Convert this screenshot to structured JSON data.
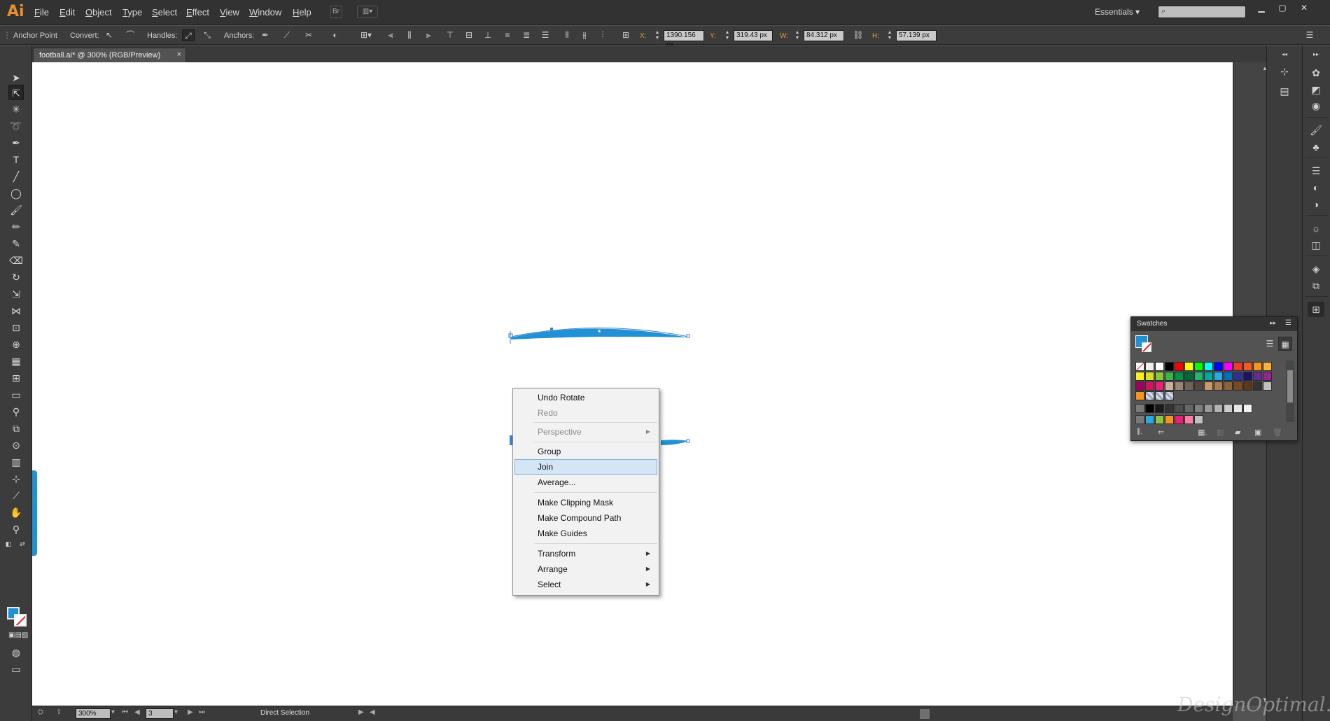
{
  "app": {
    "logo": "Ai",
    "workspace": "Essentials"
  },
  "menu": [
    {
      "label": "File",
      "u": "F",
      "rest": "ile"
    },
    {
      "label": "Edit",
      "u": "E",
      "rest": "dit"
    },
    {
      "label": "Object",
      "u": "O",
      "rest": "bject"
    },
    {
      "label": "Type",
      "u": "T",
      "rest": "ype"
    },
    {
      "label": "Select",
      "u": "S",
      "rest": "elect"
    },
    {
      "label": "Effect",
      "u": "E",
      "rest": "ffect"
    },
    {
      "label": "View",
      "u": "V",
      "rest": "iew"
    },
    {
      "label": "Window",
      "u": "W",
      "rest": "indow"
    },
    {
      "label": "Help",
      "u": "H",
      "rest": "elp"
    }
  ],
  "control": {
    "tool_name": "Anchor Point",
    "convert_label": "Convert:",
    "handles_label": "Handles:",
    "anchors_label": "Anchors:",
    "x_label": "X:",
    "x_value": "1390.156 px",
    "y_label": "Y:",
    "y_value": "319.43 px",
    "w_label": "W:",
    "w_value": "84.312 px",
    "h_label": "H:",
    "h_value": "57.139 px"
  },
  "document": {
    "tab_title": "football.ai* @ 300% (RGB/Preview)",
    "close": "×"
  },
  "status": {
    "zoom": "300%",
    "artboard": "3",
    "tool": "Direct Selection"
  },
  "swatches_panel": {
    "title": "Swatches",
    "fill_color": "#2191d6"
  },
  "context_menu": {
    "items": [
      {
        "label": "Undo Rotate",
        "disabled": false,
        "submenu": false
      },
      {
        "label": "Redo",
        "disabled": true,
        "submenu": false
      },
      {
        "label": "Perspective",
        "disabled": true,
        "submenu": true
      },
      {
        "label": "Group",
        "disabled": false,
        "submenu": false
      },
      {
        "label": "Join",
        "disabled": false,
        "submenu": false,
        "highlighted": true
      },
      {
        "label": "Average...",
        "disabled": false,
        "submenu": false
      },
      {
        "label": "Make Clipping Mask",
        "disabled": false,
        "submenu": false
      },
      {
        "label": "Make Compound Path",
        "disabled": false,
        "submenu": false
      },
      {
        "label": "Make Guides",
        "disabled": false,
        "submenu": false
      },
      {
        "label": "Transform",
        "disabled": false,
        "submenu": true
      },
      {
        "label": "Arrange",
        "disabled": false,
        "submenu": true
      },
      {
        "label": "Select",
        "disabled": false,
        "submenu": true
      }
    ]
  },
  "colors": {
    "accent_selection": "#2191d6",
    "menu_highlight": "#d4e6f6"
  },
  "watermark": "DesignOptimal.com"
}
